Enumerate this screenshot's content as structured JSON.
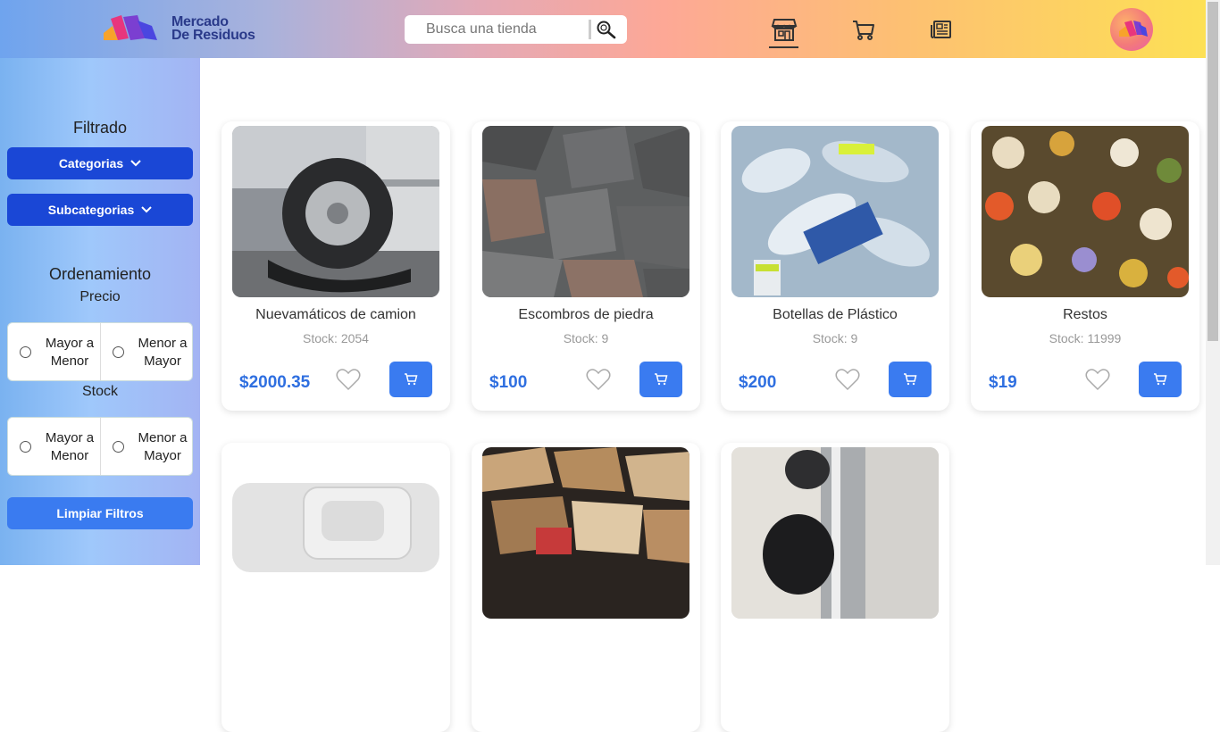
{
  "header": {
    "logo_line1": "Mercado",
    "logo_line2": "De Residuos",
    "search": {
      "placeholder": "Busca una tienda",
      "value": ""
    },
    "nav": [
      "store-icon",
      "cart-icon",
      "newspaper-icon"
    ],
    "active_nav": "store"
  },
  "sidebar": {
    "filter_title": "Filtrado",
    "categories_label": "Categorias",
    "subcategories_label": "Subcategorias",
    "sort_title": "Ordenamiento",
    "price_label": "Precio",
    "stock_label": "Stock",
    "desc_line1": "Mayor a",
    "desc_line2": "Menor",
    "asc_line1": "Menor a",
    "asc_line2": "Mayor",
    "clear_label": "Limpiar Filtros"
  },
  "products": [
    {
      "name": "Nuevamáticos de camion",
      "stock": "Stock: 2054",
      "price": "$2000.35"
    },
    {
      "name": "Escombros de piedra",
      "stock": "Stock: 9",
      "price": "$100"
    },
    {
      "name": "Botellas de Plástico",
      "stock": "Stock: 9",
      "price": "$200"
    },
    {
      "name": "Restos",
      "stock": "Stock: 11999",
      "price": "$19"
    },
    {
      "name": "",
      "stock": "",
      "price": ""
    },
    {
      "name": "",
      "stock": "",
      "price": ""
    },
    {
      "name": "",
      "stock": "",
      "price": ""
    }
  ],
  "colors": {
    "primary": "#1a47d6",
    "button": "#3a7bf0",
    "price": "#2f6fe0"
  }
}
